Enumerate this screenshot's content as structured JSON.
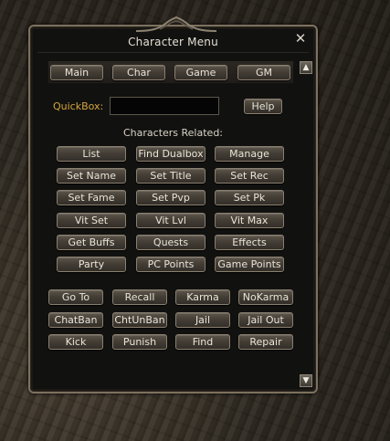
{
  "window": {
    "title": "Character Menu",
    "close_glyph": "✕"
  },
  "tabs": [
    "Main",
    "Char",
    "Game",
    "GM"
  ],
  "quickbox": {
    "label": "QuickBox:",
    "value": "",
    "help_label": "Help"
  },
  "section_title": "Characters Related:",
  "char_buttons": [
    [
      "List",
      "Find Dualbox",
      "Manage"
    ],
    [
      "Set Name",
      "Set Title",
      "Set Rec"
    ],
    [
      "Set Fame",
      "Set Pvp",
      "Set Pk"
    ],
    [
      "Vit Set",
      "Vit Lvl",
      "Vit Max"
    ],
    [
      "Get Buffs",
      "Quests",
      "Effects"
    ],
    [
      "Party",
      "PC Points",
      "Game Points"
    ]
  ],
  "action_buttons": [
    [
      "Go To",
      "Recall",
      "Karma",
      "NoKarma"
    ],
    [
      "ChatBan",
      "ChtUnBan",
      "Jail",
      "Jail Out"
    ],
    [
      "Kick",
      "Punish",
      "Find",
      "Repair"
    ]
  ],
  "icons": {
    "scroll_up": "scroll-up-arrow-icon",
    "scroll_down": "scroll-down-arrow-icon",
    "close": "close-icon"
  },
  "colors": {
    "quickbox_label": "#d6a63c",
    "window_bg": "#111110",
    "border": "#7d715e"
  }
}
